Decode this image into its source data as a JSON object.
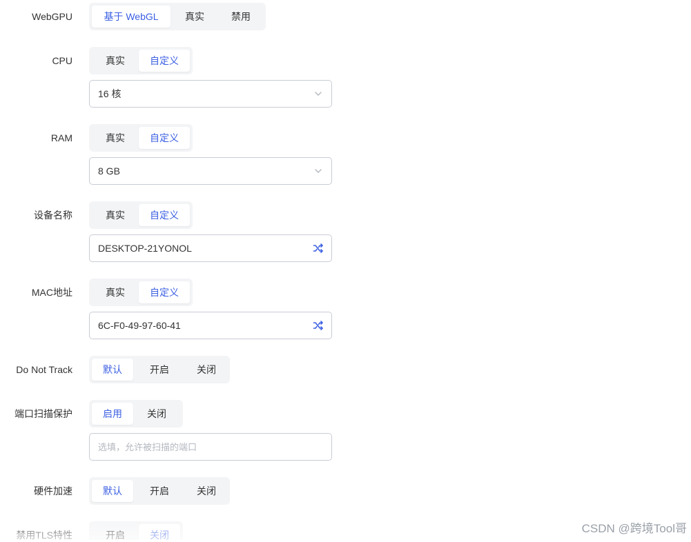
{
  "webgpu": {
    "label": "WebGPU",
    "options": [
      "基于 WebGL",
      "真实",
      "禁用"
    ],
    "selected": 0
  },
  "cpu": {
    "label": "CPU",
    "options": [
      "真实",
      "自定义"
    ],
    "selected": 1,
    "value": "16 核"
  },
  "ram": {
    "label": "RAM",
    "options": [
      "真实",
      "自定义"
    ],
    "selected": 1,
    "value": "8 GB"
  },
  "device_name": {
    "label": "设备名称",
    "options": [
      "真实",
      "自定义"
    ],
    "selected": 1,
    "value": "DESKTOP-21YONOL"
  },
  "mac": {
    "label": "MAC地址",
    "options": [
      "真实",
      "自定义"
    ],
    "selected": 1,
    "value": "6C-F0-49-97-60-41"
  },
  "dnt": {
    "label": "Do Not Track",
    "options": [
      "默认",
      "开启",
      "关闭"
    ],
    "selected": 0
  },
  "port_scan": {
    "label": "端口扫描保护",
    "options": [
      "启用",
      "关闭"
    ],
    "selected": 0,
    "placeholder": "选填，允许被扫描的端口"
  },
  "hw_accel": {
    "label": "硬件加速",
    "options": [
      "默认",
      "开启",
      "关闭"
    ],
    "selected": 0
  },
  "tls": {
    "label": "禁用TLS特性",
    "options": [
      "开启",
      "关闭"
    ],
    "selected": 1
  },
  "colors": {
    "accent": "#3b5fe2",
    "segment_bg": "#f3f4f6",
    "border": "#c8ccd4"
  },
  "icons": {
    "chevron": "chevron-down-icon",
    "shuffle": "shuffle-icon"
  },
  "watermark": "CSDN @跨境Tool哥"
}
